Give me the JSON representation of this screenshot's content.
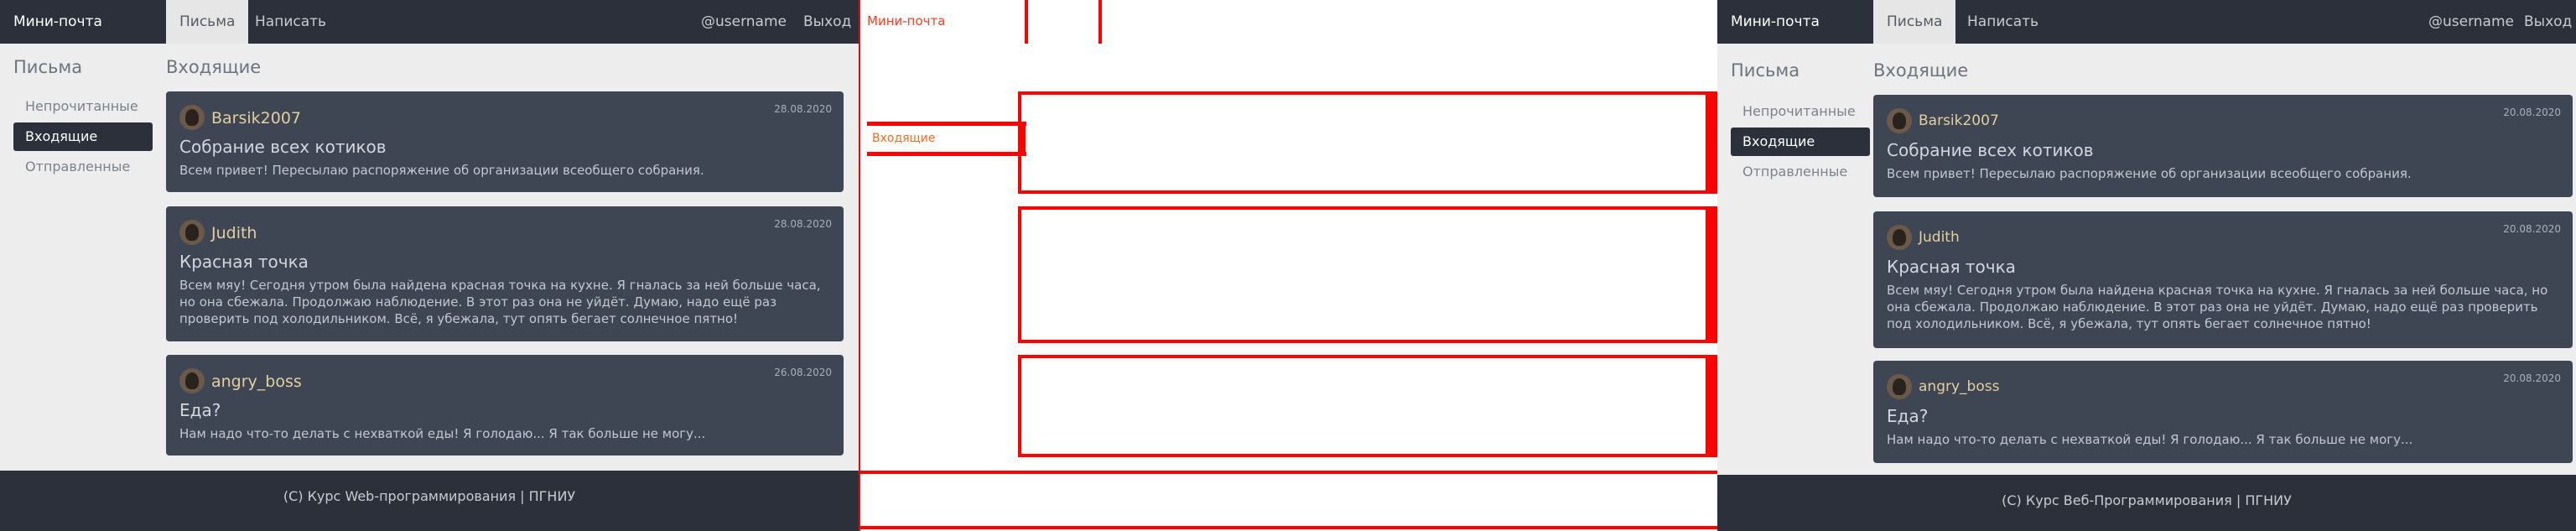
{
  "app": {
    "brand": "Мини-почта",
    "tabs": [
      {
        "label": "Письма"
      },
      {
        "label": "Написать"
      }
    ],
    "username": "@username",
    "logout": "Выход"
  },
  "sidebar": {
    "title": "Письма",
    "items": [
      {
        "label": "Непрочитанные"
      },
      {
        "label": "Входящие"
      },
      {
        "label": "Отправленные"
      }
    ]
  },
  "main": {
    "title": "Входящие",
    "messages": [
      {
        "author": "Barsik2007",
        "date": "28.08.2020",
        "subject": "Собрание всех котиков",
        "body": "Всем привет! Пересылаю распоряжение об организации всеобщего собрания."
      },
      {
        "author": "Judith",
        "date": "28.08.2020",
        "subject": "Красная точка",
        "body": "Всем мяу! Сегодня утром была найдена красная точка на кухне. Я гналась за ней больше часа, но она сбежала. Продолжаю наблюдение. В этот раз она не уйдёт. Думаю, надо ещё раз проверить под холодильником. Всё, я убежала, тут опять бегает солнечное пятно!"
      },
      {
        "author": "angry_boss",
        "date": "26.08.2020",
        "subject": "Еда?",
        "body": "Нам надо что-то делать с нехваткой еды! Я голодаю... Я так больше не могу..."
      }
    ]
  },
  "footer": {
    "text": "(C) Курс Web-программирования | ПГНИУ"
  },
  "panel3": {
    "main_dates": [
      "20.08.2020",
      "20.08.2020",
      "20.08.2020"
    ],
    "footer": "(C) Курс Веб-Программирования | ПГНИУ"
  },
  "edge_panel": {
    "brand": "Мини-почта",
    "active_item": "Входящие"
  },
  "colors": {
    "navbar": "#2b303a",
    "card": "#3e4553",
    "background": "#ededed",
    "author": "#e3cfa0",
    "edge": "#ff0000"
  }
}
